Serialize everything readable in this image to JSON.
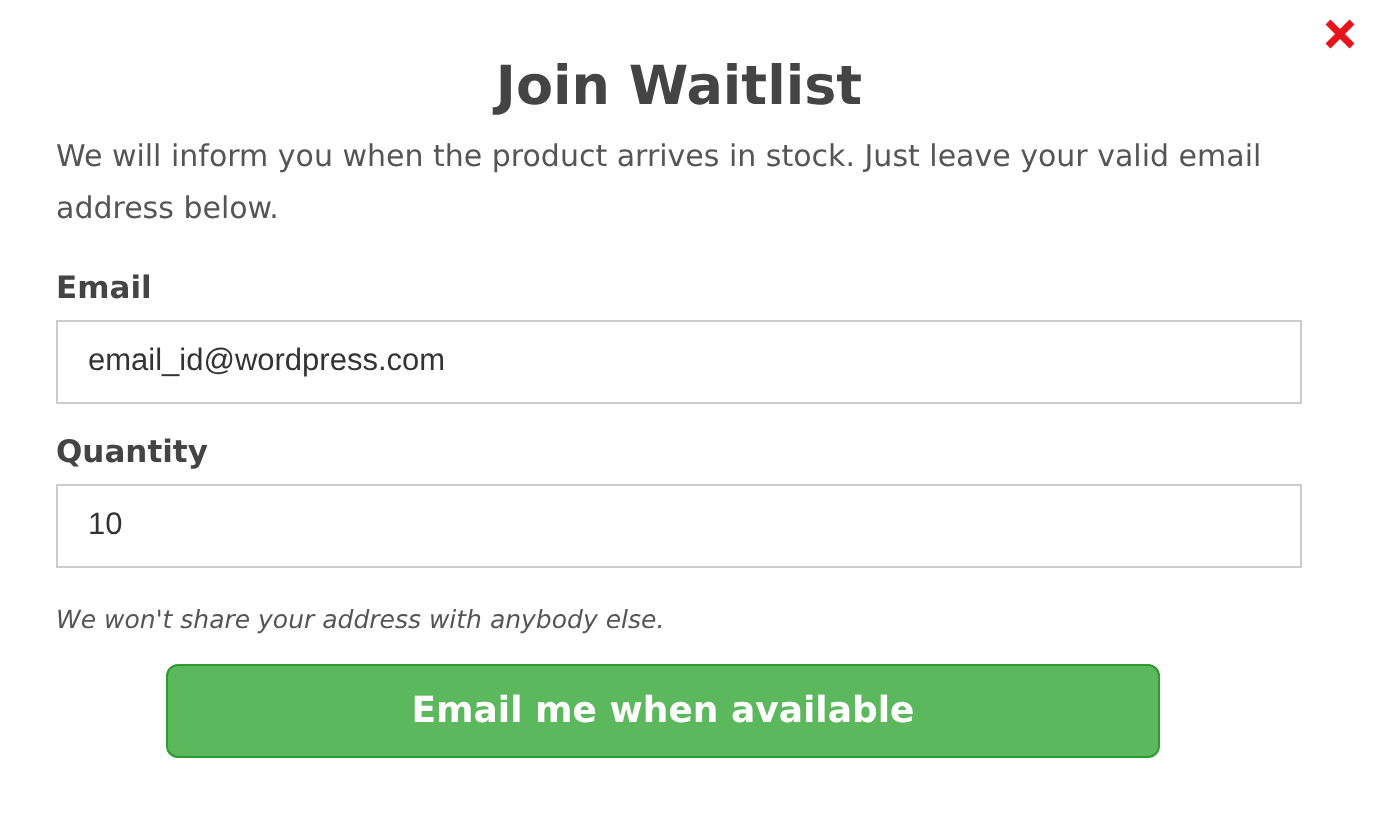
{
  "dialog": {
    "title": "Join Waitlist",
    "message": "We will inform you when the product arrives in stock. Just leave your valid email address below.",
    "fields": [
      {
        "label": "Email",
        "value": "email_id@wordpress.com"
      },
      {
        "label": "Quantity",
        "value": "10"
      }
    ],
    "note": "We won't share your address with anybody else.",
    "submit": "Email me when available"
  }
}
